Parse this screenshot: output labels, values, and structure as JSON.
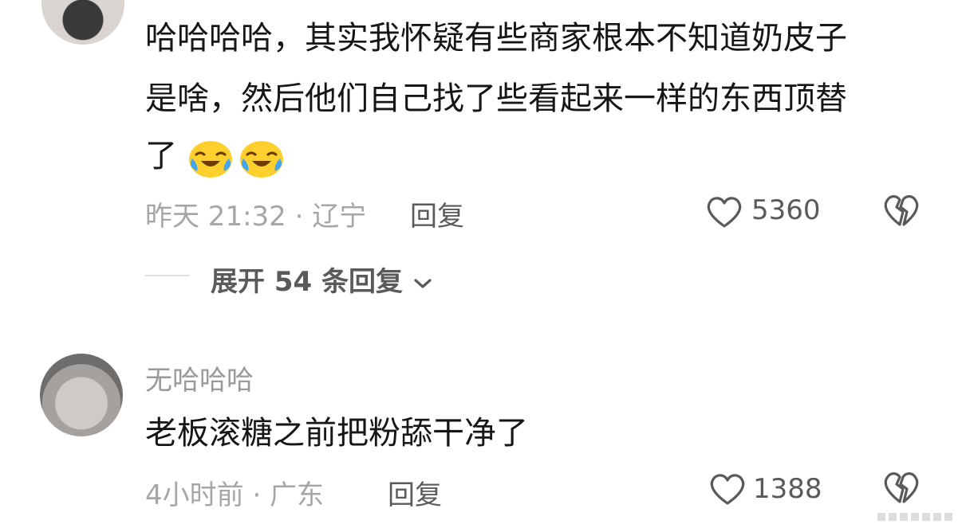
{
  "comments": [
    {
      "text_lines": [
        "哈哈哈哈，其实我怀疑有些商家根本不知道奶皮子",
        "是啥，然后他们自己找了些看起来一样的东西顶替",
        "了"
      ],
      "emoji": [
        "crying-laughing-emoji",
        "crying-laughing-emoji"
      ],
      "meta": "昨天 21:32 · 辽宁",
      "reply_label": "回复",
      "like_count": "5360",
      "expand_label": "展开 54 条回复"
    },
    {
      "username": "无哈哈哈",
      "text": "老板滚糖之前把粉舔干净了",
      "meta": "4小时前 · 广东",
      "reply_label": "回复",
      "like_count": "1388"
    }
  ],
  "colors": {
    "text": "#161616",
    "meta": "#a6a6a6",
    "secondary": "#5a5a5a",
    "emoji_yellow": "#ffcf2e",
    "emoji_tear": "#41a6f5"
  }
}
